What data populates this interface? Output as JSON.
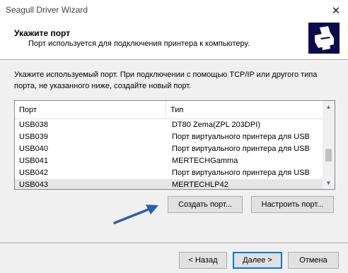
{
  "window": {
    "title": "Seagull Driver Wizard",
    "close_label": "✕"
  },
  "header": {
    "title": "Укажите порт",
    "subtitle": "Порт используется для подключения принтера к компьютеру."
  },
  "instruction": "Укажите используемый порт. При подключении с помощью TCP/IP или другого типа порта, не указанного ниже, создайте новый порт.",
  "port_list": {
    "columns": [
      "Порт",
      "Тип"
    ],
    "rows": [
      {
        "port": "USB038",
        "type": "DT80 Zema(ZPL 203DPI)"
      },
      {
        "port": "USB039",
        "type": "Порт виртуального принтера для USB"
      },
      {
        "port": "USB040",
        "type": "Порт виртуального принтера для USB"
      },
      {
        "port": "USB041",
        "type": "MERTECHGamma"
      },
      {
        "port": "USB042",
        "type": "Порт виртуального принтера для USB"
      },
      {
        "port": "USB043",
        "type": "MERTECHLP42"
      }
    ],
    "selected_port": "USB043"
  },
  "buttons": {
    "create_port": "Создать порт...",
    "configure_port": "Настроить порт...",
    "back": "< Назад",
    "next": "Далее >",
    "cancel": "Отмена"
  },
  "colors": {
    "logo_bg": "#0b0b4d",
    "annotation_arrow": "#2b5fad",
    "default_button_border": "#0078d7"
  },
  "icons": {
    "close": "close-icon",
    "logo": "printer-icon",
    "scroll_up": "chevron-up-icon",
    "scroll_down": "chevron-down-icon",
    "annotation": "arrow-icon"
  }
}
